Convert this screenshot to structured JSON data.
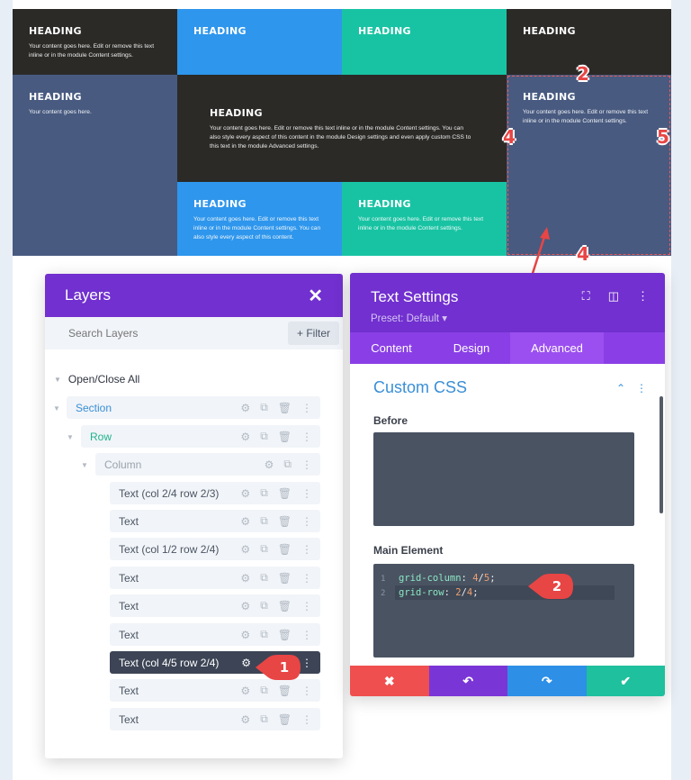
{
  "preview": {
    "cells": [
      {
        "heading": "HEADING",
        "text": "Your content goes here. Edit or remove this text inline or in the module Content settings."
      },
      {
        "heading": "HEADING",
        "text": ""
      },
      {
        "heading": "HEADING",
        "text": ""
      },
      {
        "heading": "HEADING",
        "text": ""
      },
      {
        "heading": "HEADING",
        "text": "Your content goes here."
      },
      {
        "heading": "HEADING",
        "text": "Your content goes here. Edit or remove this text inline or in the module Content settings. You can also style every aspect of this content in the module Design settings and even apply custom CSS to this text in the module Advanced settings."
      },
      {
        "heading": "HEADING",
        "text": "Your content goes here. Edit or remove this text inline or in the module Content settings."
      },
      {
        "heading": "HEADING",
        "text": "Your content goes here. Edit or remove this text inline or in the module Content settings. You can also style every aspect of this content."
      },
      {
        "heading": "HEADING",
        "text": "Your content goes here. Edit or remove this text inline or in the module Content settings."
      }
    ],
    "annotations": {
      "top": "2",
      "left": "4",
      "right": "5",
      "bottom": "4"
    }
  },
  "layers": {
    "title": "Layers",
    "search_placeholder": "Search Layers",
    "filter_label": "+ Filter",
    "open_close_all": "Open/Close All",
    "section": "Section",
    "row": "Row",
    "column": "Column",
    "items": [
      "Text (col 2/4 row 2/3)",
      "Text",
      "Text (col 1/2 row 2/4)",
      "Text",
      "Text",
      "Text",
      "Text (col 4/5 row 2/4)",
      "Text",
      "Text"
    ],
    "active_badge": "1"
  },
  "settings": {
    "title": "Text Settings",
    "preset": "Preset: Default ▾",
    "tabs": [
      "Content",
      "Design",
      "Advanced"
    ],
    "active_tab": "Advanced",
    "section_title": "Custom CSS",
    "before_label": "Before",
    "main_label": "Main Element",
    "code": [
      {
        "line": "1",
        "prop": "grid-column",
        "v1": "4",
        "v2": "5"
      },
      {
        "line": "2",
        "prop": "grid-row",
        "v1": "2",
        "v2": "4"
      }
    ],
    "code_badge": "2"
  },
  "colors": {
    "purple": "#7130cf",
    "tab_purple": "#8a3fe6",
    "dark": "#2b2a27",
    "blue": "#2e96ec",
    "teal": "#18c3a3",
    "slate": "#485a80",
    "red": "#e84545",
    "footer": [
      "#ef4f4f",
      "#7a35d6",
      "#2d8fe6",
      "#1fc09e"
    ]
  }
}
